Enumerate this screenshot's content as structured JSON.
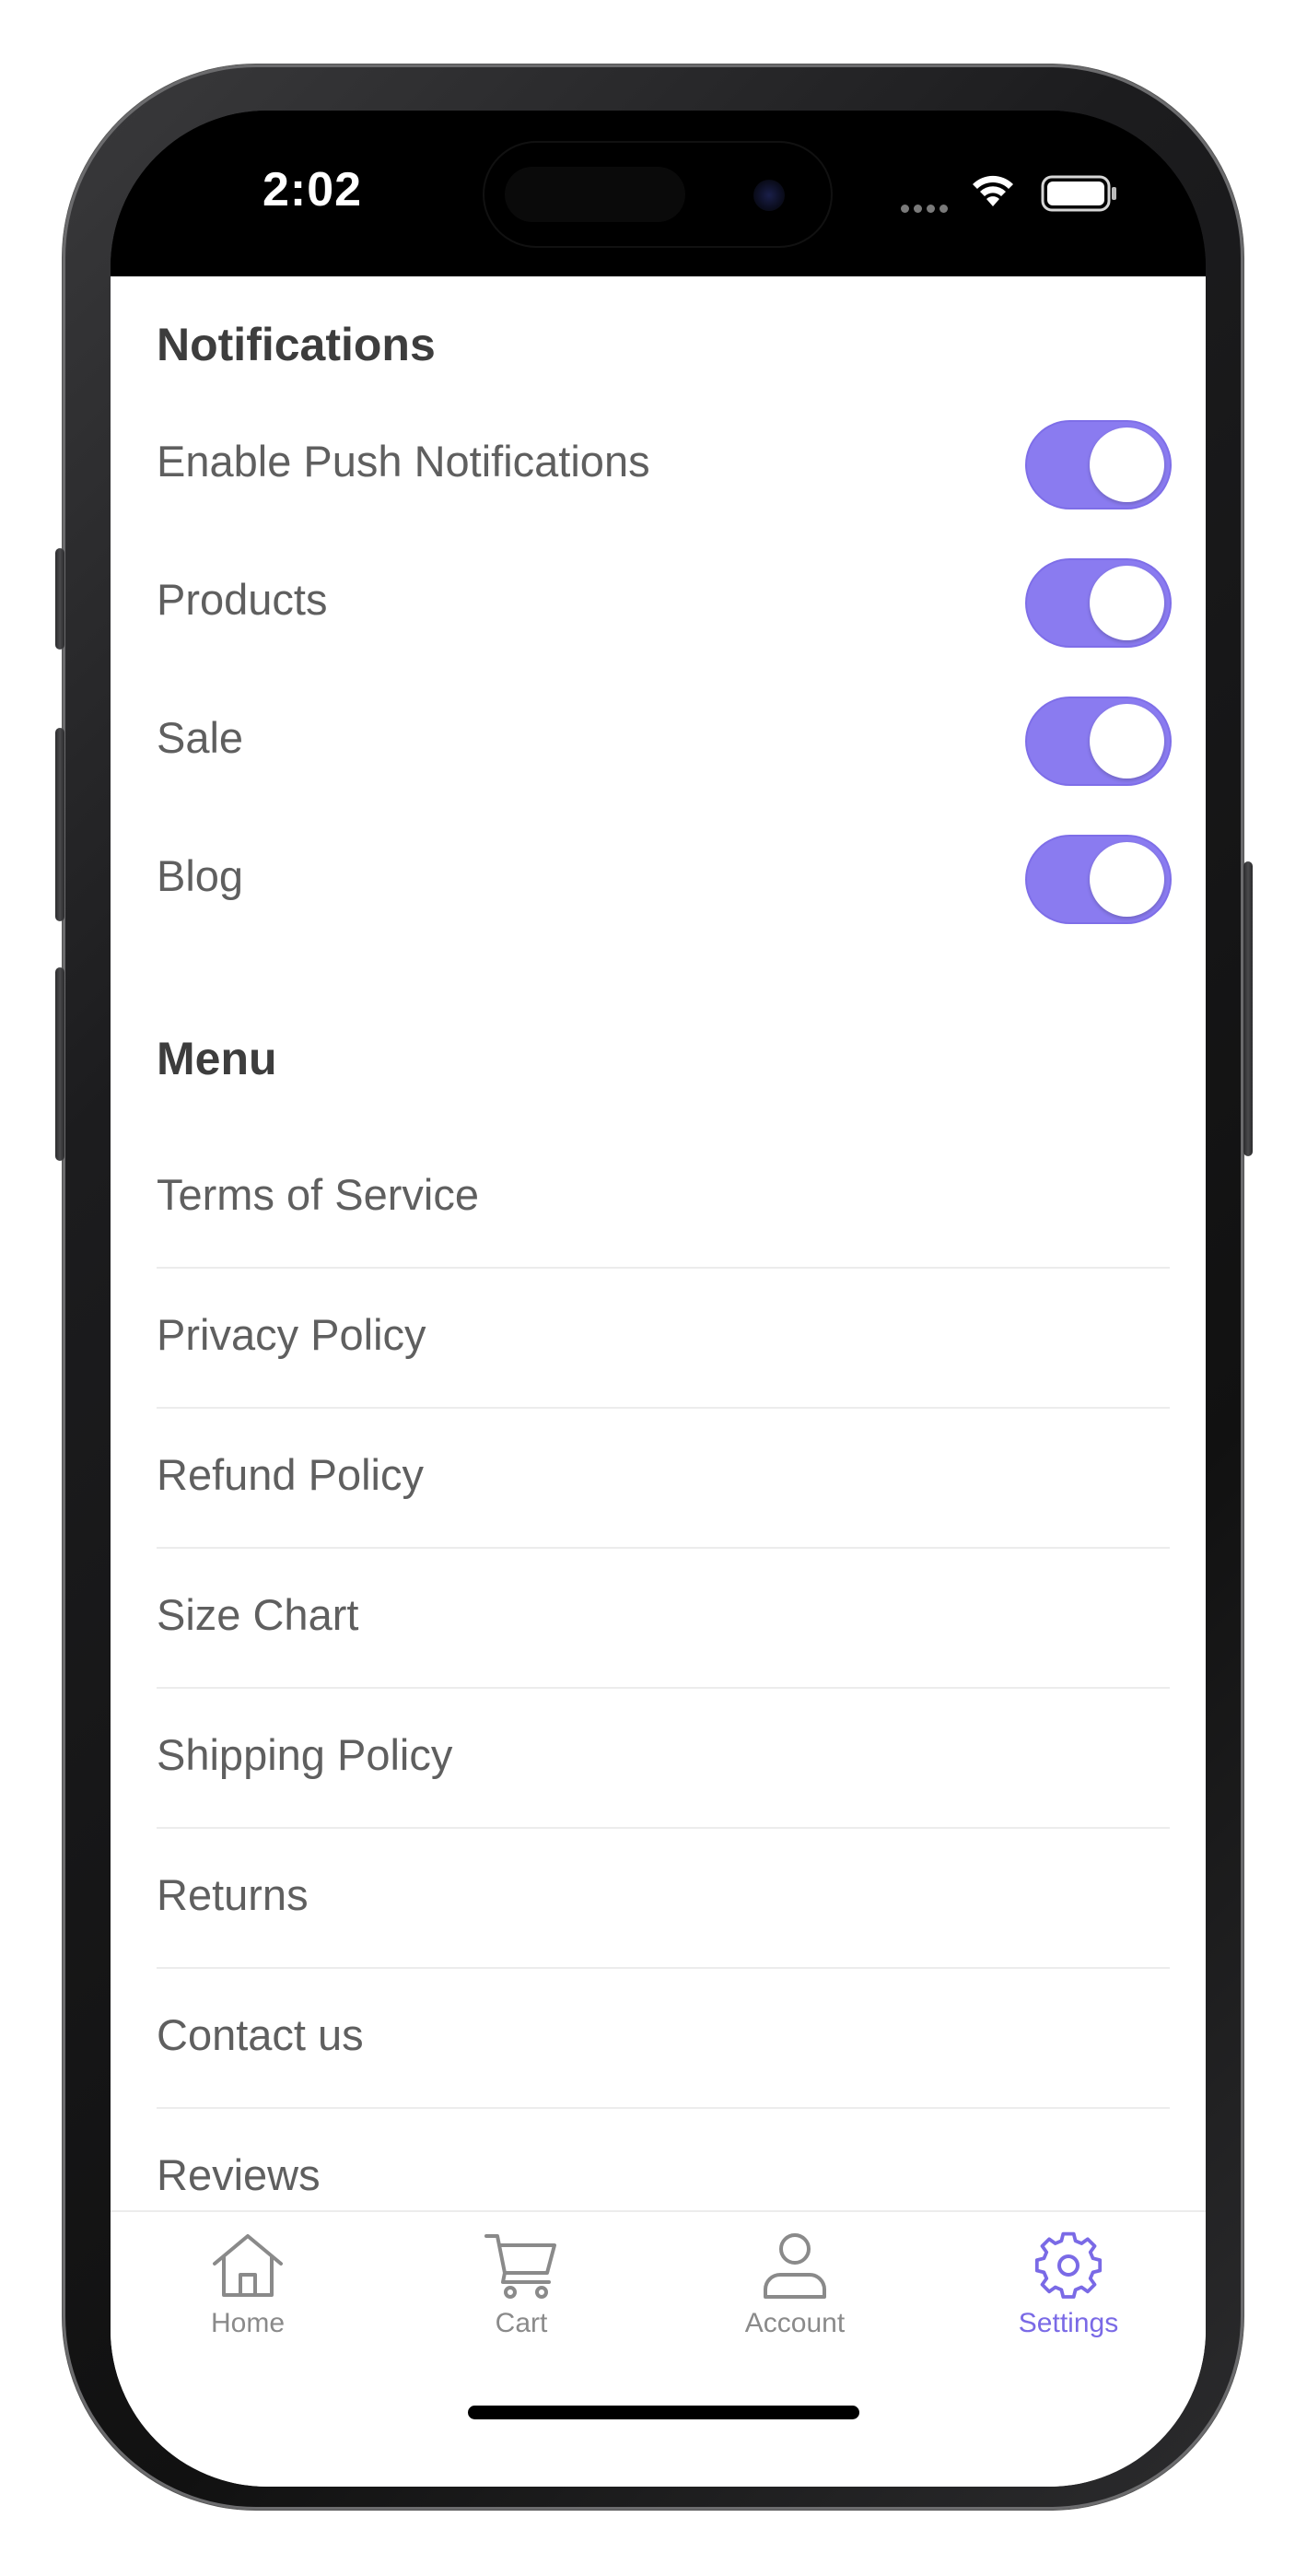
{
  "status_bar": {
    "time": "2:02"
  },
  "notifications": {
    "title": "Notifications",
    "toggles": [
      {
        "label": "Enable Push Notifications",
        "on": true
      },
      {
        "label": "Products",
        "on": true
      },
      {
        "label": "Sale",
        "on": true
      },
      {
        "label": "Blog",
        "on": true
      }
    ]
  },
  "menu": {
    "title": "Menu",
    "items": [
      {
        "label": "Terms of Service"
      },
      {
        "label": "Privacy Policy"
      },
      {
        "label": "Refund Policy"
      },
      {
        "label": "Size Chart"
      },
      {
        "label": "Shipping Policy"
      },
      {
        "label": "Returns"
      },
      {
        "label": "Contact us"
      },
      {
        "label": "Reviews"
      }
    ]
  },
  "tab_bar": {
    "tabs": [
      {
        "label": "Home",
        "icon": "home-icon",
        "active": false
      },
      {
        "label": "Cart",
        "icon": "cart-icon",
        "active": false
      },
      {
        "label": "Account",
        "icon": "account-icon",
        "active": false
      },
      {
        "label": "Settings",
        "icon": "settings-icon",
        "active": true
      }
    ]
  },
  "colors": {
    "accent": "#8a7bf0",
    "active_tab": "#7a6ae6",
    "text": "#5f5f5f",
    "heading": "#3d3d3d"
  }
}
